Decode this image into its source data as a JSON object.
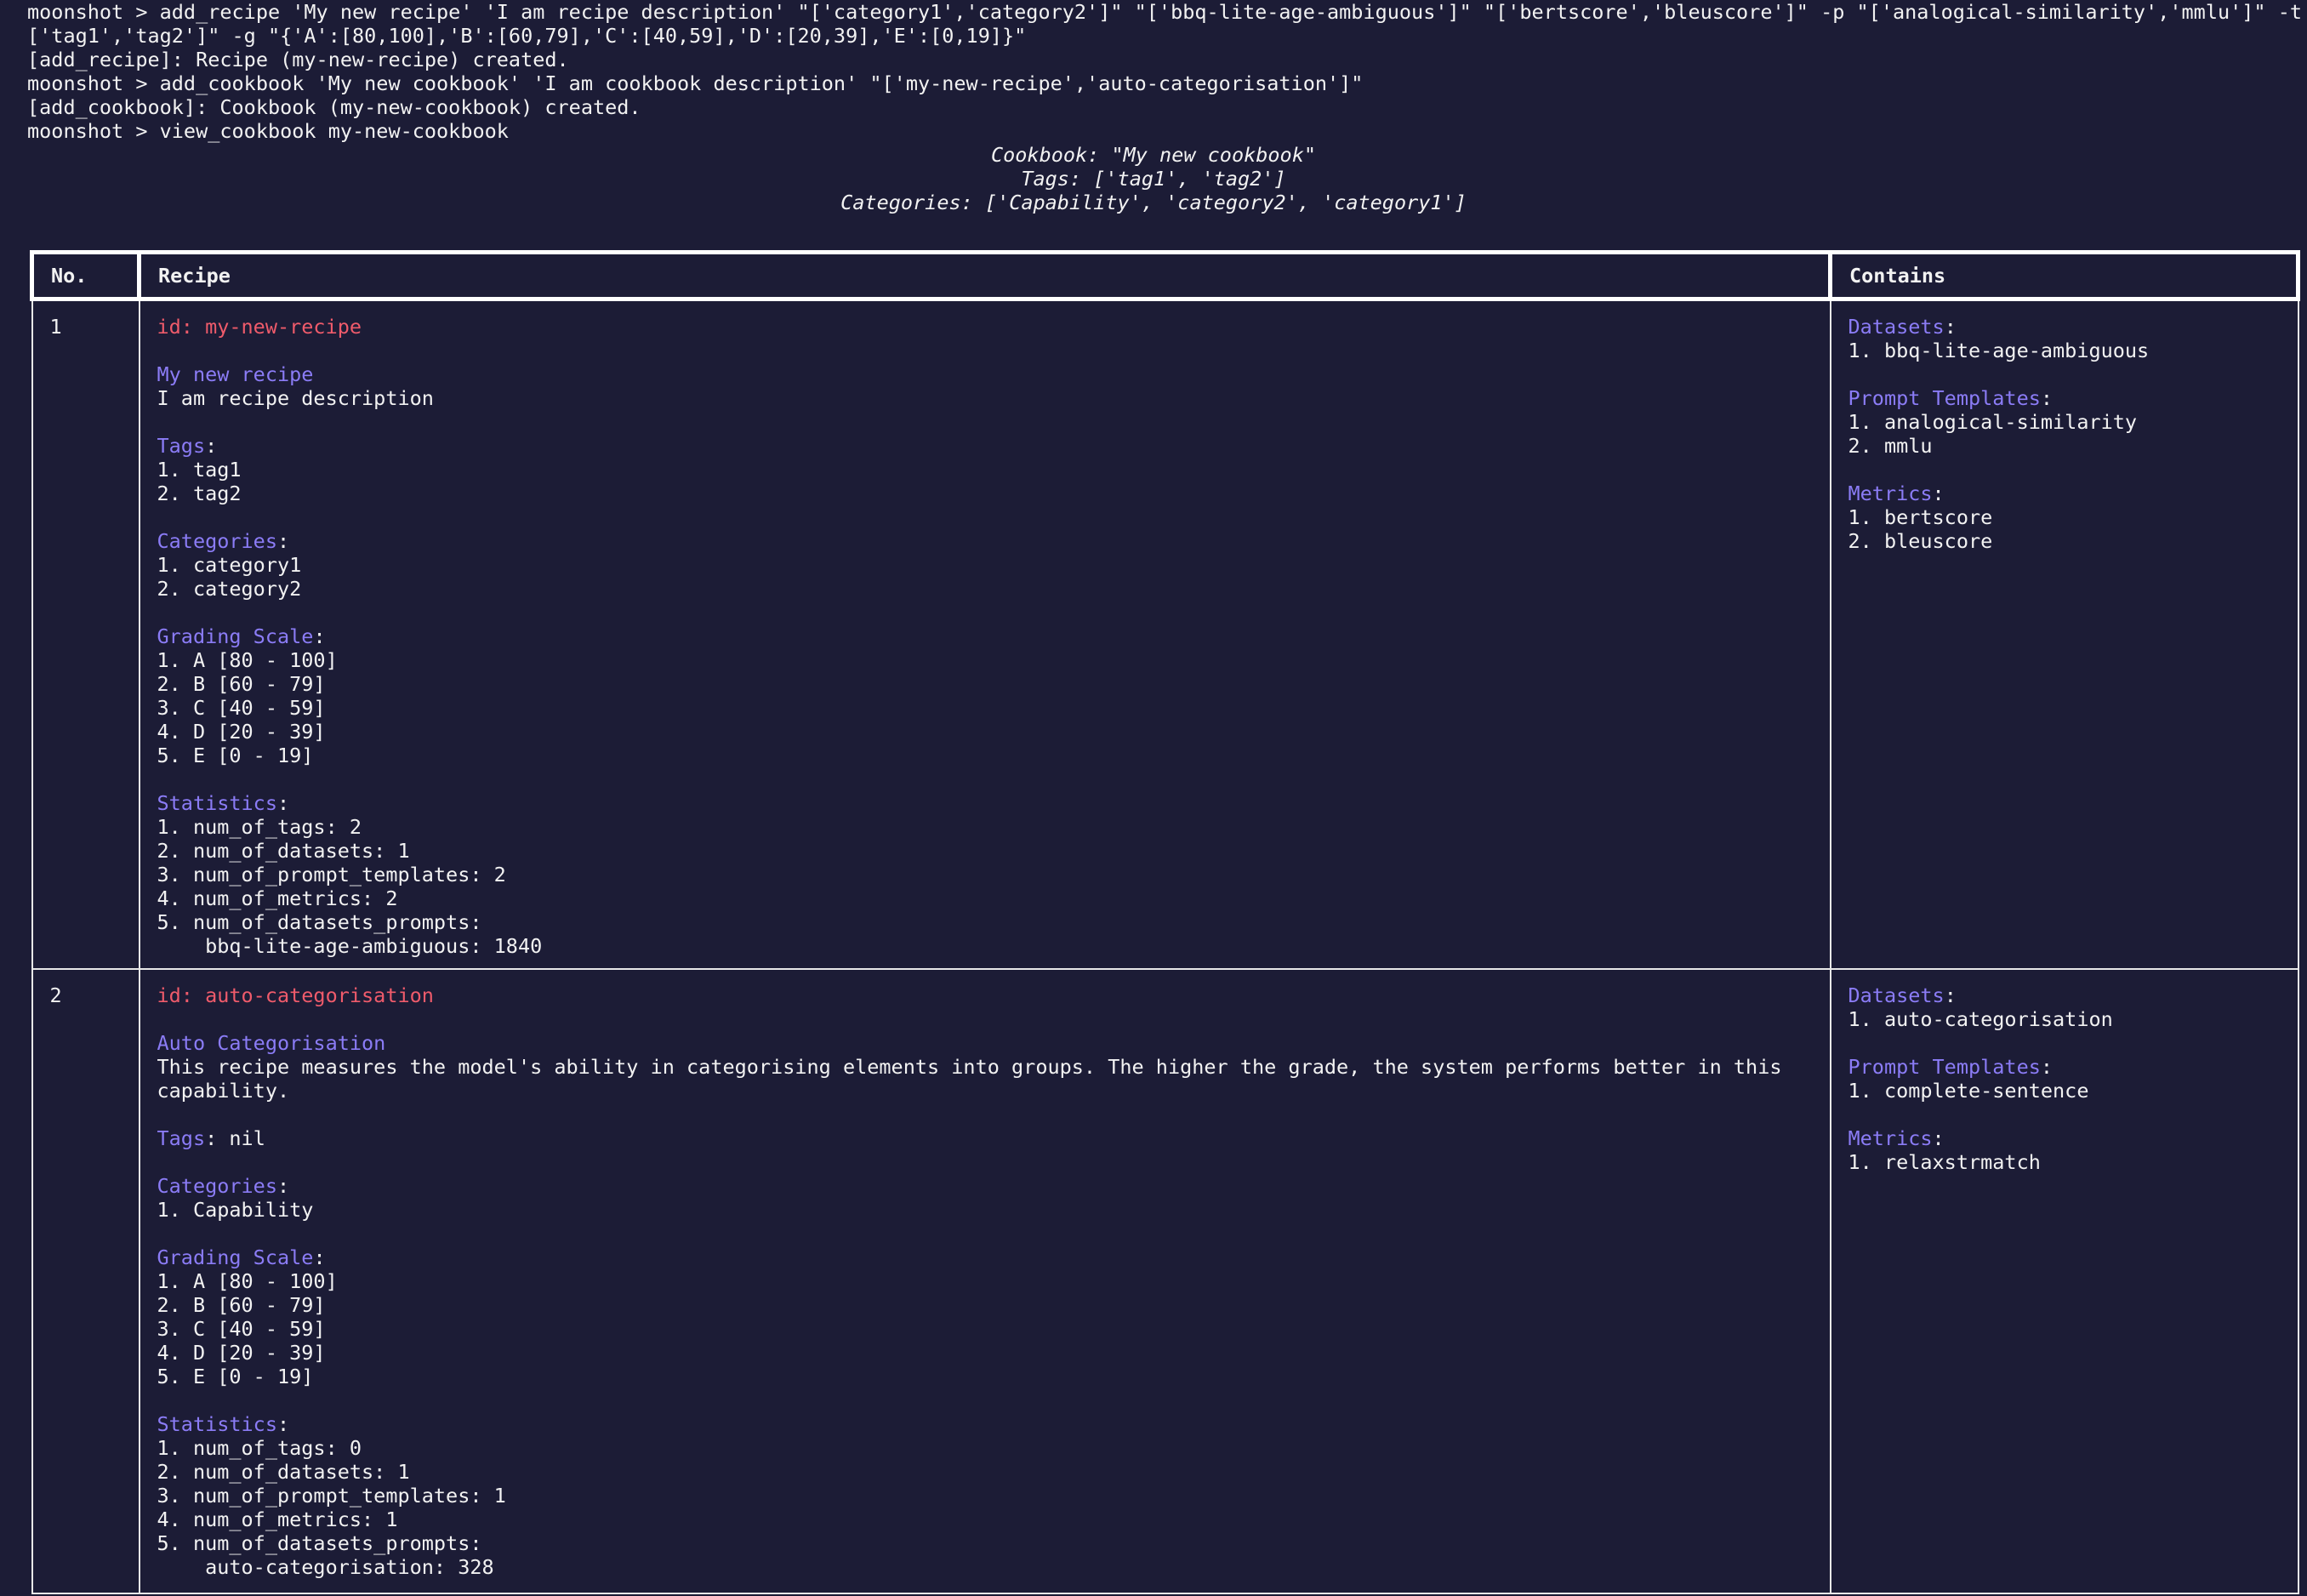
{
  "terminal": {
    "lines": [
      "moonshot > add_recipe 'My new recipe' 'I am recipe description' \"['category1','category2']\" \"['bbq-lite-age-ambiguous']\" \"['bertscore','bleuscore']\" -p \"['analogical-similarity','mmlu']\" -t \"",
      "['tag1','tag2']\" -g \"{'A':[80,100],'B':[60,79],'C':[40,59],'D':[20,39],'E':[0,19]}\"",
      "[add_recipe]: Recipe (my-new-recipe) created.",
      "moonshot > add_cookbook 'My new cookbook' 'I am cookbook description' \"['my-new-recipe','auto-categorisation']\"",
      "[add_cookbook]: Cookbook (my-new-cookbook) created.",
      "moonshot > view_cookbook my-new-cookbook"
    ]
  },
  "cookbook_header": {
    "title": "Cookbook: \"My new cookbook\"",
    "tags": "Tags: ['tag1', 'tag2']",
    "categories": "Categories: ['Capability', 'category2', 'category1']"
  },
  "table": {
    "columns": [
      "No.",
      "Recipe",
      "Contains"
    ],
    "labels": {
      "tags": "Tags",
      "categories": "Categories",
      "grading_scale": "Grading Scale",
      "statistics": "Statistics",
      "datasets": "Datasets",
      "prompt_templates": "Prompt Templates",
      "metrics": "Metrics",
      "colon": ":"
    },
    "rows": [
      {
        "no": "1",
        "id": "id: my-new-recipe",
        "name": "My new recipe",
        "description": "I am recipe description",
        "tags_inline": "",
        "tags": [
          "1. tag1",
          "2. tag2"
        ],
        "categories": [
          "1. category1",
          "2. category2"
        ],
        "grading_scale": [
          "1. A [80 - 100]",
          "2. B [60 - 79]",
          "3. C [40 - 59]",
          "4. D [20 - 39]",
          "5. E [0 - 19]"
        ],
        "statistics": [
          "1. num_of_tags: 2",
          "2. num_of_datasets: 1",
          "3. num_of_prompt_templates: 2",
          "4. num_of_metrics: 2",
          "5. num_of_datasets_prompts:",
          "    bbq-lite-age-ambiguous: 1840"
        ],
        "datasets": [
          "1. bbq-lite-age-ambiguous"
        ],
        "prompt_templates": [
          "1. analogical-similarity",
          "2. mmlu"
        ],
        "metrics": [
          "1. bertscore",
          "2. bleuscore"
        ]
      },
      {
        "no": "2",
        "id": "id: auto-categorisation",
        "name": "Auto Categorisation",
        "description": "This recipe measures the model's ability in categorising elements into groups. The higher the grade, the system performs better in this capability.",
        "tags_inline": " nil",
        "tags": [],
        "categories": [
          "1. Capability"
        ],
        "grading_scale": [
          "1. A [80 - 100]",
          "2. B [60 - 79]",
          "3. C [40 - 59]",
          "4. D [20 - 39]",
          "5. E [0 - 19]"
        ],
        "statistics": [
          "1. num_of_tags: 0",
          "2. num_of_datasets: 1",
          "3. num_of_prompt_templates: 1",
          "4. num_of_metrics: 1",
          "5. num_of_datasets_prompts:",
          "    auto-categorisation: 328"
        ],
        "datasets": [
          "1. auto-categorisation"
        ],
        "prompt_templates": [
          "1. complete-sentence"
        ],
        "metrics": [
          "1. relaxstrmatch"
        ]
      }
    ]
  }
}
